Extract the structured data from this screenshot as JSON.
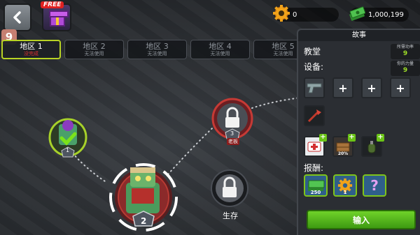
{
  "topbar": {
    "free_tag": "FREE",
    "player_level": "9",
    "gears": "0",
    "cash": "1,000,199"
  },
  "tabs": [
    {
      "name": "地区 1",
      "status": "没完成",
      "active": true
    },
    {
      "name": "地区 2",
      "status": "无法使用",
      "active": false
    },
    {
      "name": "地区 3",
      "status": "无法使用",
      "active": false
    },
    {
      "name": "地区 4",
      "status": "无法使用",
      "active": false
    },
    {
      "name": "地区 5",
      "status": "无法使用",
      "active": false
    }
  ],
  "map": {
    "node_1_number": "1",
    "node_2_number": "2",
    "node_3_number": "3",
    "boss_label": "老板",
    "survival_label": "生存"
  },
  "panel": {
    "title": "故事",
    "location": "教堂",
    "required_power_label": "所需功率",
    "required_power_value": "9",
    "your_power_label": "你的力量",
    "your_power_value": "9",
    "equipment_label": "设备:",
    "supply_counts": [
      "",
      "20%",
      ""
    ],
    "rewards_label": "报酬:",
    "rewards": [
      {
        "icon": "cash-stack-icon",
        "count": "250"
      },
      {
        "icon": "gear-icon",
        "count": "1"
      },
      {
        "icon": "mystery-icon",
        "count": "?"
      }
    ],
    "enter_label": "输入"
  },
  "colors": {
    "accent_green": "#9fe028",
    "tab_active_border": "#b8d324",
    "status_red": "#e03030"
  }
}
